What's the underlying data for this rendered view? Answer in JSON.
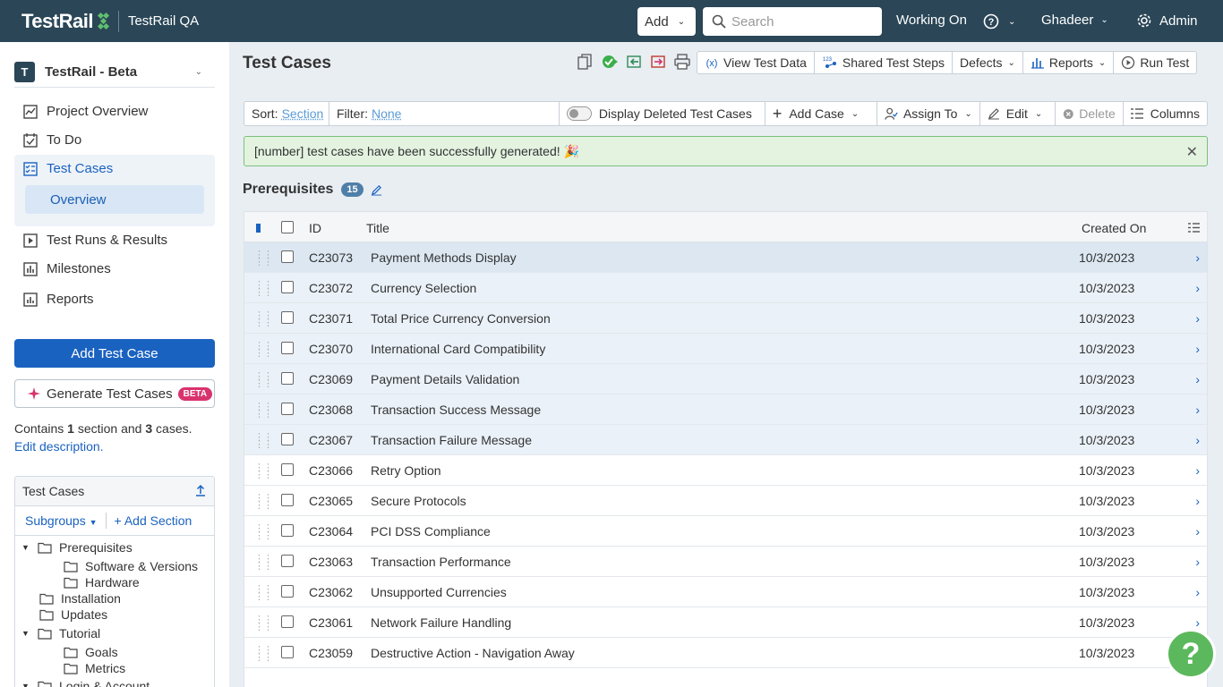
{
  "topbar": {
    "logo_text": "TestRail",
    "project_label": "TestRail QA",
    "add_label": "Add",
    "search_placeholder": "Search",
    "working_on": "Working On",
    "user": "Ghadeer",
    "admin": "Admin"
  },
  "sidebar": {
    "project_initial": "T",
    "project_title": "TestRail - Beta",
    "nav": [
      {
        "label": "Project Overview"
      },
      {
        "label": "To Do"
      },
      {
        "label": "Test Cases"
      },
      {
        "label": "Test Runs & Results"
      },
      {
        "label": "Milestones"
      },
      {
        "label": "Reports"
      }
    ],
    "sub_nav": {
      "label": "Overview"
    },
    "add_test_case": "Add Test Case",
    "generate": "Generate Test Cases",
    "beta": "BETA",
    "contains_pre": "Contains ",
    "contains_sections": "1",
    "contains_mid": " section and ",
    "contains_cases": "3",
    "contains_post": " cases.",
    "edit_description": "Edit description.",
    "tree": {
      "title": "Test Cases",
      "subgroups": "Subgroups",
      "add_section": "Add Section",
      "nodes": [
        {
          "label": "Prerequisites"
        },
        {
          "label": "Software & Versions"
        },
        {
          "label": "Hardware"
        },
        {
          "label": "Installation"
        },
        {
          "label": "Updates"
        },
        {
          "label": "Tutorial"
        },
        {
          "label": "Goals"
        },
        {
          "label": "Metrics"
        },
        {
          "label": "Login & Account"
        }
      ]
    }
  },
  "main": {
    "title": "Test Cases",
    "toolbar": {
      "view_test_data": "View Test Data",
      "shared_test_steps": "Shared Test Steps",
      "defects": "Defects",
      "reports": "Reports",
      "run_test": "Run Test"
    },
    "sortbar": {
      "sort_label": "Sort:",
      "sort_value": "Section",
      "filter_label": "Filter:",
      "filter_value": "None",
      "display_deleted": "Display Deleted Test Cases",
      "add_case": "Add Case",
      "assign_to": "Assign To",
      "edit": "Edit",
      "delete": "Delete",
      "columns": "Columns"
    },
    "alert": "[number] test cases have been successfully generated! 🎉",
    "section": {
      "title": "Prerequisites",
      "count": "15"
    },
    "table": {
      "headers": {
        "id": "ID",
        "title": "Title",
        "created_on": "Created On"
      },
      "rows": [
        {
          "id": "C23073",
          "title": "Payment Methods Display",
          "date": "10/3/2023"
        },
        {
          "id": "C23072",
          "title": "Currency Selection",
          "date": "10/3/2023"
        },
        {
          "id": "C23071",
          "title": "Total Price Currency Conversion",
          "date": "10/3/2023"
        },
        {
          "id": "C23070",
          "title": "International Card Compatibility",
          "date": "10/3/2023"
        },
        {
          "id": "C23069",
          "title": "Payment Details Validation",
          "date": "10/3/2023"
        },
        {
          "id": "C23068",
          "title": "Transaction Success Message",
          "date": "10/3/2023"
        },
        {
          "id": "C23067",
          "title": "Transaction Failure Message",
          "date": "10/3/2023"
        },
        {
          "id": "C23066",
          "title": "Retry Option",
          "date": "10/3/2023"
        },
        {
          "id": "C23065",
          "title": "Secure Protocols",
          "date": "10/3/2023"
        },
        {
          "id": "C23064",
          "title": "PCI DSS Compliance",
          "date": "10/3/2023"
        },
        {
          "id": "C23063",
          "title": "Transaction Performance",
          "date": "10/3/2023"
        },
        {
          "id": "C23062",
          "title": "Unsupported Currencies",
          "date": "10/3/2023"
        },
        {
          "id": "C23061",
          "title": "Network Failure Handling",
          "date": "10/3/2023"
        },
        {
          "id": "C23059",
          "title": "Destructive Action - Navigation Away",
          "date": "10/3/2023"
        }
      ]
    }
  },
  "help_label": "?"
}
